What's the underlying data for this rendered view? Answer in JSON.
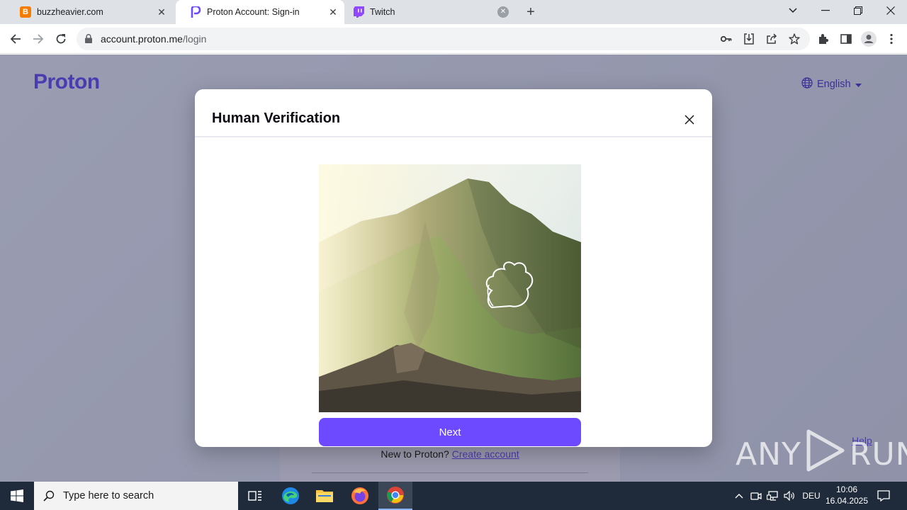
{
  "browser": {
    "tabs": [
      {
        "title": "buzzheavier.com",
        "favicon": "blogger-b-icon",
        "active": false
      },
      {
        "title": "Proton Account: Sign-in",
        "favicon": "proton-p-icon",
        "active": true
      },
      {
        "title": "Twitch",
        "favicon": "twitch-icon",
        "active": false
      }
    ],
    "url_host": "account.proton.me",
    "url_path": "/login"
  },
  "page": {
    "logo": "Proton",
    "language": "English",
    "new_to_text": "New to Proton?",
    "create_account": "Create account",
    "help": "Help"
  },
  "modal": {
    "title": "Human Verification",
    "next_label": "Next"
  },
  "watermark": {
    "left": "ANY",
    "right": "RUN"
  },
  "taskbar": {
    "search_placeholder": "Type here to search",
    "language": "DEU",
    "time": "10:06",
    "date": "16.04.2025"
  },
  "colors": {
    "brand": "#6d4aff",
    "proton_text": "#4a3bb0",
    "taskbar": "#1f2b3a"
  }
}
